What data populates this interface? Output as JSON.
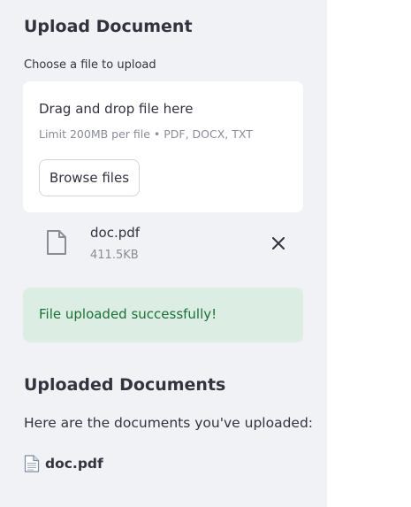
{
  "sidebar": {
    "upload_heading": "Upload Document",
    "uploader": {
      "label": "Choose a file to upload",
      "dropzone_title": "Drag and drop file here",
      "dropzone_limit": "Limit 200MB per file • PDF, DOCX, TXT",
      "browse_label": "Browse files",
      "file": {
        "name": "doc.pdf",
        "size": "411.5KB",
        "icon": "file-icon",
        "remove_icon": "close-icon"
      }
    },
    "success_message": "File uploaded successfully!",
    "uploaded_heading": "Uploaded Documents",
    "uploaded_intro": "Here are the documents you've uploaded:",
    "documents": [
      {
        "icon": "page-icon",
        "name": "doc.pdf"
      }
    ]
  },
  "colors": {
    "sidebar_bg": "#f0f2f6",
    "success_bg": "#dcede4",
    "success_text": "#177233",
    "text": "#31333f",
    "muted": "#8a8d97"
  }
}
